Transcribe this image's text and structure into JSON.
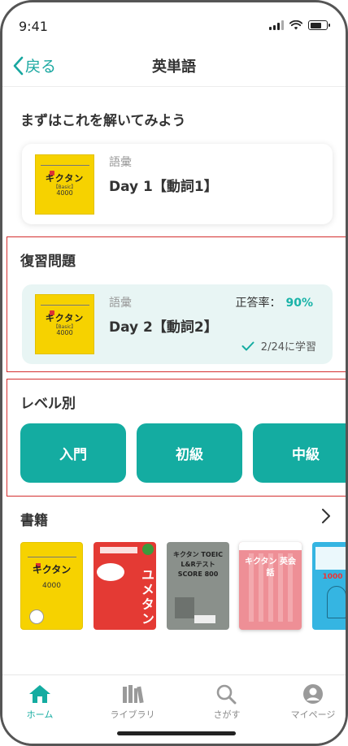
{
  "status_bar": {
    "time": "9:41"
  },
  "nav": {
    "back_label": "戻る",
    "title": "英単語"
  },
  "first_section": {
    "title": "まずはこれを解いてみよう",
    "card": {
      "category": "語彙",
      "title": "Day 1【動詞1】"
    }
  },
  "review_section": {
    "title": "復習問題",
    "card": {
      "category": "語彙",
      "title": "Day 2【動詞2】",
      "rate_label": "正答率：",
      "rate_value": "90%",
      "studied": "2/24に学習"
    }
  },
  "level_section": {
    "title": "レベル別",
    "buttons": [
      "入門",
      "初級",
      "中級"
    ]
  },
  "books_section": {
    "title": "書籍",
    "books": [
      {
        "title": "キクタン",
        "sub": "4000"
      },
      {
        "title": "ユメタン"
      },
      {
        "title": "キクタン TOEIC L&Rテスト SCORE 800"
      },
      {
        "title": "キクタン 英会話"
      },
      {
        "title": "1000"
      }
    ]
  },
  "book_cover": {
    "title": "キクタン",
    "sub": "4000",
    "mid": "【Basic】"
  },
  "tabbar": {
    "items": [
      {
        "label": "ホーム",
        "icon": "home-icon",
        "active": true
      },
      {
        "label": "ライブラリ",
        "icon": "library-icon",
        "active": false
      },
      {
        "label": "さがす",
        "icon": "search-icon",
        "active": false
      },
      {
        "label": "マイページ",
        "icon": "user-icon",
        "active": false
      }
    ]
  },
  "colors": {
    "accent": "#14aca1",
    "highlight_border": "#d42f2f",
    "review_bg": "#e8f5f4"
  }
}
